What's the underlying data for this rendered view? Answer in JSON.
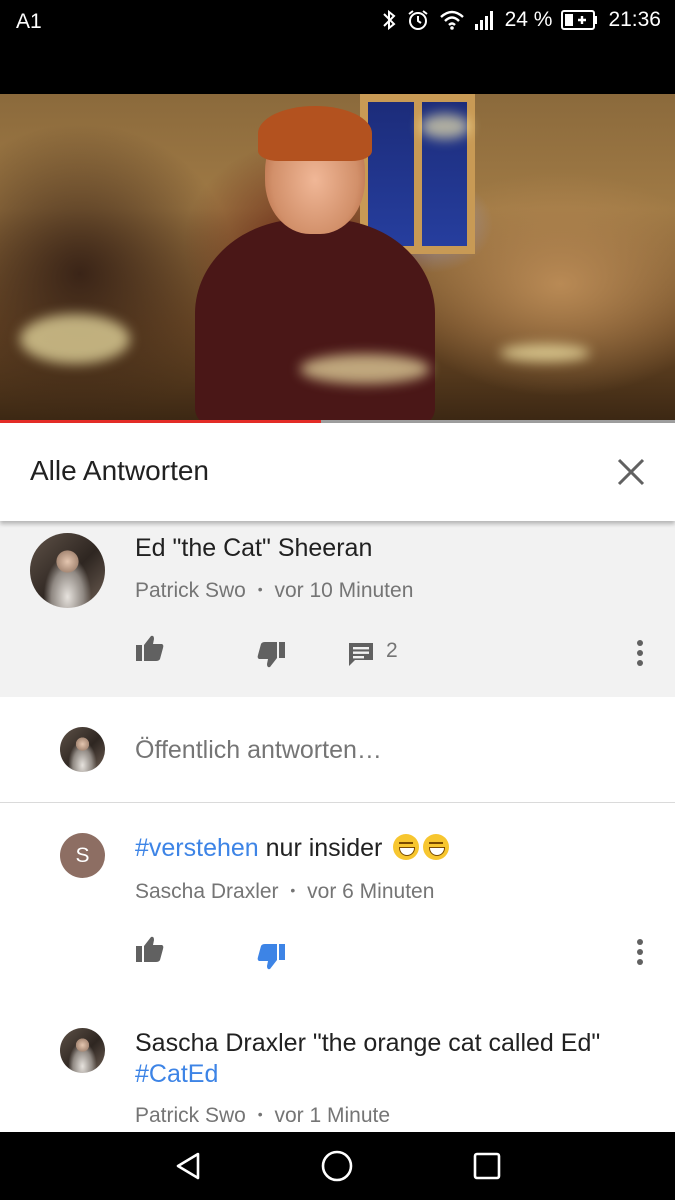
{
  "status_bar": {
    "carrier": "A1",
    "battery_percent": "24 %",
    "time": "21:36",
    "icons": [
      "bluetooth-icon",
      "alarm-icon",
      "wifi-icon",
      "signal-icon",
      "battery-charging-icon"
    ]
  },
  "video": {
    "progress": 0.475,
    "progress_color": "#e52d27"
  },
  "sheet": {
    "title": "Alle Antworten",
    "close_icon": "close-icon"
  },
  "parent_comment": {
    "text": "Ed \"the Cat\" Sheeran",
    "author": "Patrick Swo",
    "separator": "•",
    "time": "vor 10 Minuten",
    "reply_count": "2"
  },
  "reply_input": {
    "placeholder": "Öffentlich antworten…"
  },
  "replies": [
    {
      "avatar_letter": "S",
      "hashtag": "#verstehen",
      "text": " nur insider",
      "emoji": "😁😁",
      "author": "Sascha Draxler",
      "separator": "•",
      "time": "vor 6 Minuten",
      "disliked": true
    },
    {
      "text": "Sascha Draxler \"the orange cat called Ed\"",
      "hashtag": "#CatEd",
      "author": "Patrick Swo",
      "separator": "•",
      "time": "vor 1 Minute"
    }
  ],
  "colors": {
    "accent_blue": "#3d84e6",
    "muted_text": "#757575",
    "icon_gray": "#616161"
  }
}
